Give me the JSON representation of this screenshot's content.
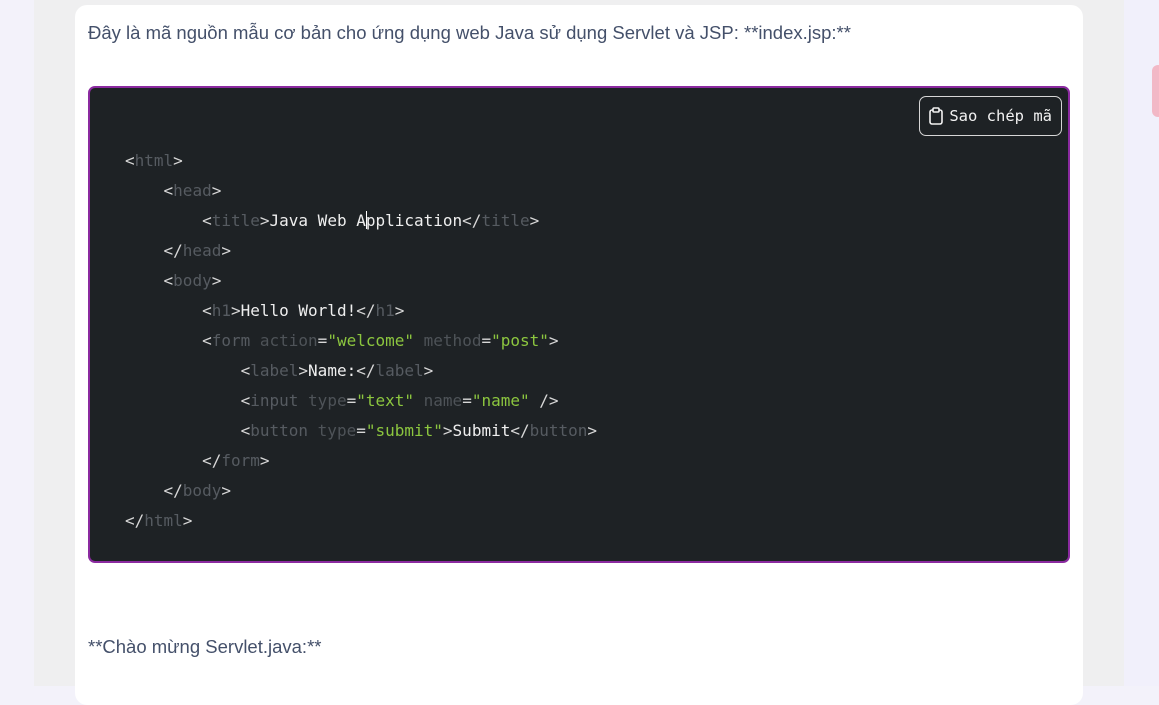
{
  "message": {
    "intro": "Đây là mã nguồn mẫu cơ bản cho ứng dụng web Java sử dụng Servlet và JSP: **index.jsp:**",
    "footer": "**Chào mừng Servlet.java:**"
  },
  "code_block": {
    "copy_label": "Sao chép mã",
    "copy_icon": "clipboard-icon",
    "border_color": "#8b2aa0",
    "background_color": "#1e2225",
    "lines": {
      "l1": {
        "p0": "<",
        "t0": "html",
        "p1": ">"
      },
      "l2": {
        "p0": "<",
        "t0": "head",
        "p1": ">"
      },
      "l3": {
        "p0": "<",
        "t0": "title",
        "p1": ">",
        "text_a": "Java Web A",
        "text_b": "pplication",
        "p2": "</",
        "t1": "title",
        "p3": ">"
      },
      "l4": {
        "p0": "</",
        "t0": "head",
        "p1": ">"
      },
      "l5": {
        "p0": "<",
        "t0": "body",
        "p1": ">"
      },
      "l6": {
        "p0": "<",
        "t0": "h1",
        "p1": ">",
        "text": "Hello World!",
        "p2": "</",
        "t1": "h1",
        "p3": ">"
      },
      "l7": {
        "p0": "<",
        "t0": "form",
        "a0": "action",
        "eq0": "=",
        "s0": "\"welcome\"",
        "a1": "method",
        "eq1": "=",
        "s1": "\"post\"",
        "p1": ">"
      },
      "l8": {
        "p0": "<",
        "t0": "label",
        "p1": ">",
        "text": "Name:",
        "p2": "</",
        "t1": "label",
        "p3": ">"
      },
      "l9": {
        "p0": "<",
        "t0": "input",
        "a0": "type",
        "eq0": "=",
        "s0": "\"text\"",
        "a1": "name",
        "eq1": "=",
        "s1": "\"name\"",
        "p1": "/>"
      },
      "l10": {
        "p0": "<",
        "t0": "button",
        "a0": "type",
        "eq0": "=",
        "s0": "\"submit\"",
        "p1": ">",
        "text": "Submit",
        "p2": "</",
        "t1": "button",
        "p3": ">"
      },
      "l11": {
        "p0": "</",
        "t0": "form",
        "p1": ">"
      },
      "l12": {
        "p0": "</",
        "t0": "body",
        "p1": ">"
      },
      "l13": {
        "p0": "</",
        "t0": "html",
        "p1": ">"
      }
    }
  }
}
